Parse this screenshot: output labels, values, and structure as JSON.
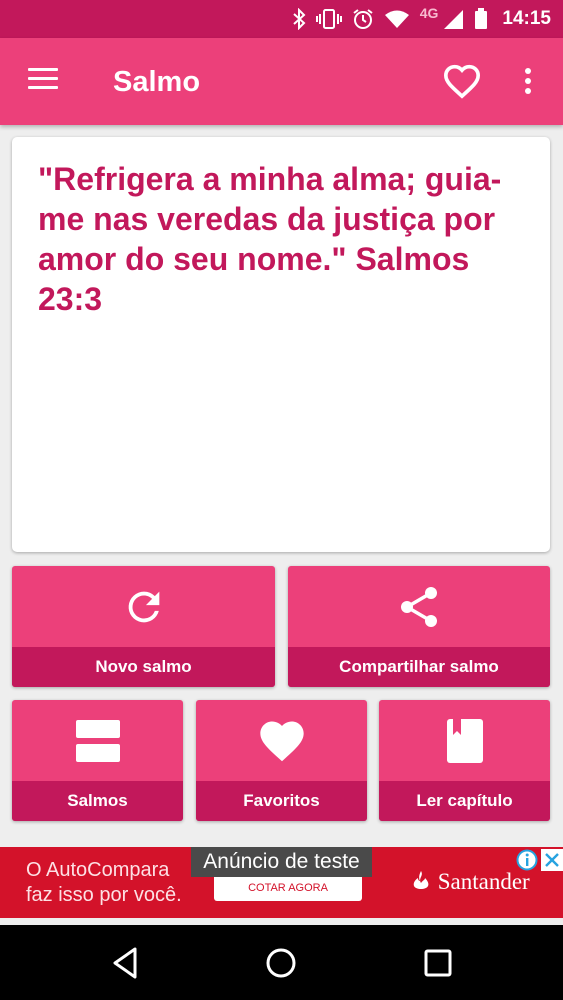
{
  "status_bar": {
    "network_type": "4G",
    "time": "14:15",
    "icons": [
      "bluetooth-icon",
      "vibrate-icon",
      "alarm-icon",
      "wifi-icon",
      "signal-icon",
      "battery-icon"
    ]
  },
  "app_bar": {
    "title": "Salmo",
    "menu_icon": "hamburger-menu-icon",
    "favorite_icon": "heart-outline-icon",
    "overflow_icon": "more-vert-icon"
  },
  "verse": {
    "text": "\"Refrigera a minha alma; guia-me nas veredas da justiça por amor do seu nome.\" Salmos 23:3"
  },
  "actions": [
    {
      "label": "Novo salmo",
      "icon": "refresh-icon"
    },
    {
      "label": "Compartilhar salmo",
      "icon": "share-icon"
    },
    {
      "label": "Salmos",
      "icon": "list-icon"
    },
    {
      "label": "Favoritos",
      "icon": "heart-icon"
    },
    {
      "label": "Ler capítulo",
      "icon": "book-icon"
    }
  ],
  "ad": {
    "test_label": "Anúncio de teste",
    "left_text_line1": "O AutoCompara",
    "left_text_line2": "faz isso por você.",
    "cta": "COTAR AGORA",
    "brand": "Santander"
  },
  "nav_bar": {
    "icons": [
      "back-icon",
      "home-icon",
      "recents-icon"
    ]
  },
  "colors": {
    "primary": "#ec407a",
    "primary_dark": "#c2185b",
    "background": "#eeeeee",
    "ad_red": "#d3122a"
  }
}
